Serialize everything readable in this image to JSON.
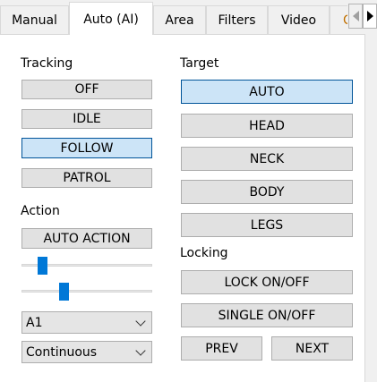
{
  "tabs": [
    {
      "label": "Manual"
    },
    {
      "label": "Auto (AI)"
    },
    {
      "label": "Area"
    },
    {
      "label": "Filters"
    },
    {
      "label": "Video"
    },
    {
      "label": "C"
    }
  ],
  "active_tab": "Auto (AI)",
  "tracking": {
    "label": "Tracking",
    "modes": [
      "OFF",
      "IDLE",
      "FOLLOW",
      "PATROL"
    ],
    "selected": "FOLLOW"
  },
  "action": {
    "label": "Action",
    "button": "AUTO ACTION",
    "slider1_level": 0.13,
    "slider2_level": 0.31,
    "select1": {
      "value": "A1"
    },
    "select2": {
      "value": "Continuous"
    }
  },
  "target": {
    "label": "Target",
    "options": [
      "AUTO",
      "HEAD",
      "NECK",
      "BODY",
      "LEGS"
    ],
    "selected": "AUTO"
  },
  "locking": {
    "label": "Locking",
    "lock_toggle": "LOCK ON/OFF",
    "single_toggle": "SINGLE ON/OFF",
    "prev": "PREV",
    "next": "NEXT"
  },
  "colors": {
    "accent": "#0078d7",
    "selected_fill": "#cce4f7",
    "selected_border": "#005499",
    "button_fill": "#e1e1e1"
  },
  "icons": {
    "tab_scroll_left": "triangle-left-icon",
    "tab_scroll_right": "triangle-right-icon",
    "combo_dropdown": "chevron-down-icon"
  }
}
